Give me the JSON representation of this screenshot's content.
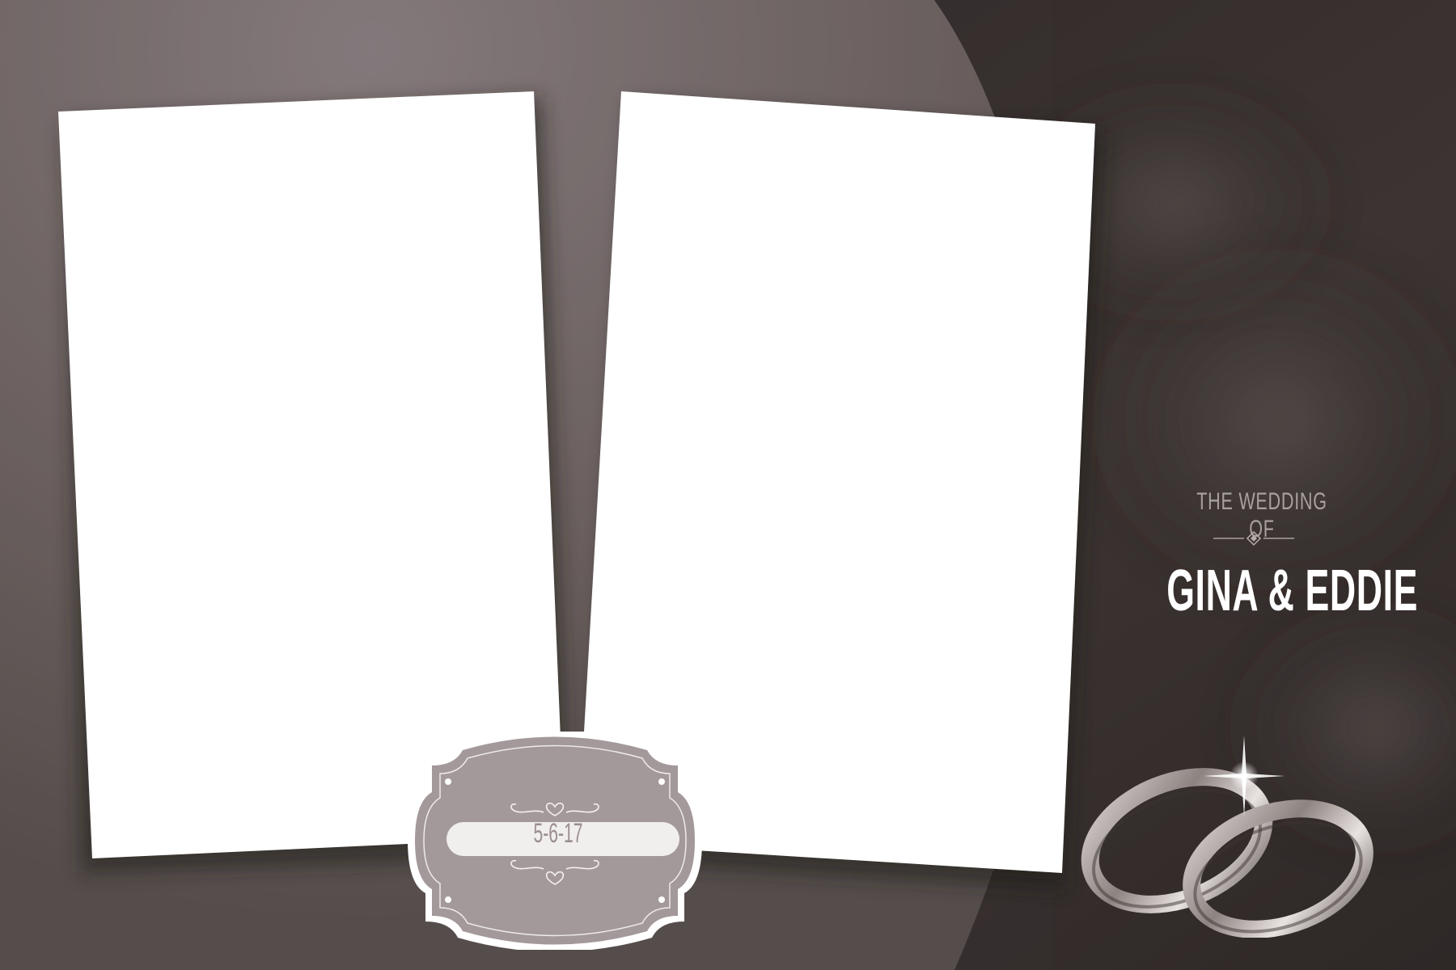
{
  "card": {
    "eyebrow": "THE WEDDING OF",
    "names": "GINA & EDDIE",
    "date": "5-6-17"
  },
  "colors": {
    "background_dark": "#4e4644",
    "arc_light": "#8a7e7c",
    "badge_fill": "#a4999a",
    "badge_border": "#ffffff",
    "date_bar": "#f1eeee",
    "eyebrow_text": "#a9a0a0",
    "names_text": "#ffffff",
    "photo_slot": "#ffffff"
  },
  "icons": [
    "heart-ornament-icon",
    "diamond-divider-icon",
    "wedding-rings-icon",
    "sparkle-icon"
  ]
}
